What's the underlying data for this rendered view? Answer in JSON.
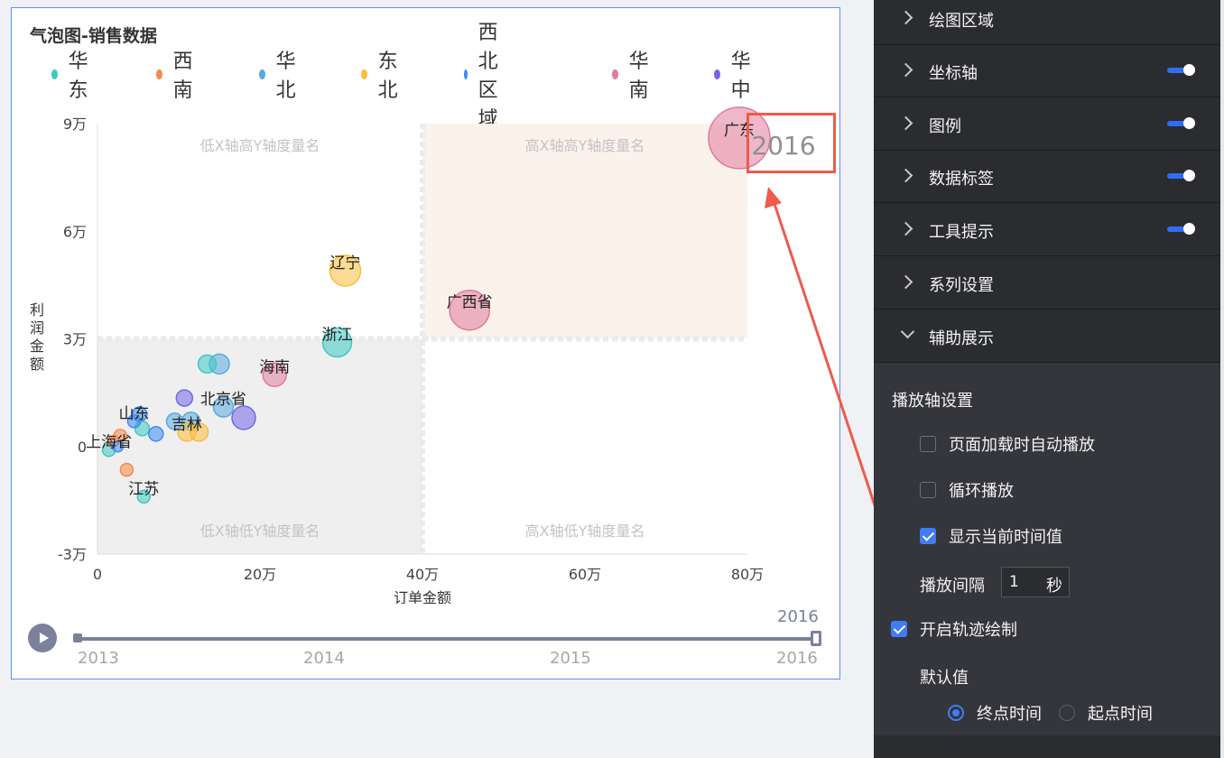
{
  "chart": {
    "title": "气泡图-销售数据",
    "legend": [
      {
        "label": "华东",
        "color": "#3ec9c2"
      },
      {
        "label": "西南",
        "color": "#f7894a"
      },
      {
        "label": "华北",
        "color": "#5aa9e0"
      },
      {
        "label": "东北",
        "color": "#fbbd3c"
      },
      {
        "label": "西北区域",
        "color": "#3d8bf2"
      },
      {
        "label": "华南",
        "color": "#e07b9e"
      },
      {
        "label": "华中",
        "color": "#7466e8"
      }
    ],
    "quadrant_labels": {
      "top_left": "低X轴高Y轴度量名",
      "top_right": "高X轴高Y轴度量名",
      "bottom_left": "低X轴低Y轴度量名",
      "bottom_right": "高X轴低Y轴度量名"
    },
    "current_year_display": "2016",
    "play_axis": {
      "years": [
        "2013",
        "2014",
        "2015",
        "2016"
      ],
      "current": "2016",
      "play_icon": "play-icon"
    }
  },
  "chart_data": {
    "type": "scatter",
    "title": "气泡图-销售数据",
    "xlabel": "订单金额",
    "ylabel": "利润金额",
    "xlim": [
      0,
      800000
    ],
    "ylim": [
      -30000,
      90000
    ],
    "x_ticks": [
      {
        "value": 0,
        "label": "0"
      },
      {
        "value": 200000,
        "label": "20万"
      },
      {
        "value": 400000,
        "label": "40万"
      },
      {
        "value": 600000,
        "label": "60万"
      },
      {
        "value": 800000,
        "label": "80万"
      }
    ],
    "y_ticks": [
      {
        "value": -30000,
        "label": "-3万"
      },
      {
        "value": 0,
        "label": "0"
      },
      {
        "value": 30000,
        "label": "3万"
      },
      {
        "value": 60000,
        "label": "6万"
      },
      {
        "value": 90000,
        "label": "9万"
      }
    ],
    "quadrant_split": {
      "x": 400000,
      "y": 30000
    },
    "legend_position": "top",
    "series": [
      {
        "name": "华东",
        "color": "#3ec9c2",
        "points": [
          {
            "x": 295000,
            "y": 29000,
            "size": 16,
            "label": "浙江"
          },
          {
            "x": 57000,
            "y": -14000,
            "size": 7,
            "label": "江苏"
          },
          {
            "x": 14000,
            "y": -1000,
            "size": 7,
            "label": "上海省"
          },
          {
            "x": 135000,
            "y": 23000,
            "size": 10,
            "label": ""
          },
          {
            "x": 55000,
            "y": 5000,
            "size": 8,
            "label": ""
          }
        ]
      },
      {
        "name": "西南",
        "color": "#f7894a",
        "points": [
          {
            "x": 36000,
            "y": -6500,
            "size": 7,
            "label": ""
          },
          {
            "x": 28000,
            "y": 3000,
            "size": 7,
            "label": ""
          },
          {
            "x": 20000,
            "y": 1500,
            "size": 6,
            "label": ""
          }
        ]
      },
      {
        "name": "华北",
        "color": "#5aa9e0",
        "points": [
          {
            "x": 155000,
            "y": 11000,
            "size": 11,
            "label": "北京省"
          },
          {
            "x": 95000,
            "y": 7000,
            "size": 9,
            "label": ""
          },
          {
            "x": 115000,
            "y": 7000,
            "size": 10,
            "label": ""
          },
          {
            "x": 150000,
            "y": 23000,
            "size": 11,
            "label": ""
          }
        ]
      },
      {
        "name": "东北",
        "color": "#fbbd3c",
        "points": [
          {
            "x": 305000,
            "y": 49000,
            "size": 17,
            "label": "辽宁"
          },
          {
            "x": 110000,
            "y": 4000,
            "size": 10,
            "label": "吉林"
          },
          {
            "x": 125000,
            "y": 4000,
            "size": 10,
            "label": ""
          }
        ]
      },
      {
        "name": "西北区域",
        "color": "#3d8bf2",
        "points": [
          {
            "x": 52000,
            "y": 9000,
            "size": 8,
            "label": ""
          },
          {
            "x": 45000,
            "y": 7000,
            "size": 7,
            "label": "山东"
          },
          {
            "x": 72000,
            "y": 3500,
            "size": 8,
            "label": ""
          },
          {
            "x": 25000,
            "y": 0,
            "size": 6,
            "label": ""
          }
        ]
      },
      {
        "name": "华南",
        "color": "#e07b9e",
        "points": [
          {
            "x": 790000,
            "y": 86000,
            "size": 34,
            "label": "广东"
          },
          {
            "x": 458000,
            "y": 38000,
            "size": 22,
            "label": "广西省"
          },
          {
            "x": 218000,
            "y": 20000,
            "size": 13,
            "label": "海南"
          }
        ]
      },
      {
        "name": "华中",
        "color": "#7466e8",
        "points": [
          {
            "x": 180000,
            "y": 8000,
            "size": 13,
            "label": ""
          },
          {
            "x": 107000,
            "y": 13500,
            "size": 9,
            "label": ""
          }
        ]
      }
    ]
  },
  "panel": {
    "rows": [
      {
        "label": "绘图区域",
        "toggle": false
      },
      {
        "label": "坐标轴",
        "toggle": true
      },
      {
        "label": "图例",
        "toggle": true
      },
      {
        "label": "数据标签",
        "toggle": true
      },
      {
        "label": "工具提示",
        "toggle": true
      },
      {
        "label": "系列设置",
        "toggle": false
      },
      {
        "label": "辅助展示",
        "toggle": false,
        "expanded": true
      }
    ],
    "aux": {
      "section_title": "播放轴设置",
      "auto_play_label": "页面加载时自动播放",
      "auto_play_checked": false,
      "loop_label": "循环播放",
      "loop_checked": false,
      "show_time_label": "显示当前时间值",
      "show_time_checked": true,
      "interval_label": "播放间隔",
      "interval_value": "1",
      "interval_unit": "秒",
      "trajectory_label": "开启轨迹绘制",
      "trajectory_checked": true,
      "default_label": "默认值",
      "radio_end_label": "终点时间",
      "radio_start_label": "起点时间",
      "selected_default": "终点时间"
    }
  },
  "colors": {
    "annotation": "#f05a4a",
    "accent": "#3f7cf7",
    "panel_bg": "#2b2c30"
  }
}
